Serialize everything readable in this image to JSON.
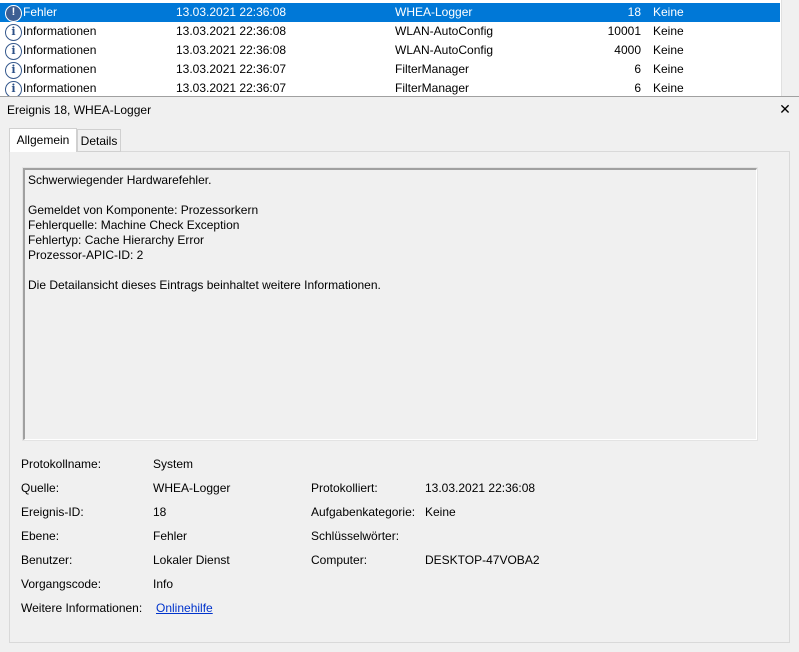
{
  "event_list": {
    "rows": [
      {
        "icon": "error-icon",
        "level": "Fehler",
        "date": "13.03.2021 22:36:08",
        "source": "WHEA-Logger",
        "id": "18",
        "category": "Keine",
        "selected": true
      },
      {
        "icon": "info-icon",
        "level": "Informationen",
        "date": "13.03.2021 22:36:08",
        "source": "WLAN-AutoConfig",
        "id": "10001",
        "category": "Keine"
      },
      {
        "icon": "info-icon",
        "level": "Informationen",
        "date": "13.03.2021 22:36:08",
        "source": "WLAN-AutoConfig",
        "id": "4000",
        "category": "Keine"
      },
      {
        "icon": "info-icon",
        "level": "Informationen",
        "date": "13.03.2021 22:36:07",
        "source": "FilterManager",
        "id": "6",
        "category": "Keine"
      },
      {
        "icon": "info-icon",
        "level": "Informationen",
        "date": "13.03.2021 22:36:07",
        "source": "FilterManager",
        "id": "6",
        "category": "Keine"
      }
    ]
  },
  "detail": {
    "title": "Ereignis 18, WHEA-Logger",
    "close_label": "✕"
  },
  "tabs": {
    "general": "Allgemein",
    "details": "Details"
  },
  "description": {
    "lines": [
      "Schwerwiegender Hardwarefehler.",
      "",
      "Gemeldet von Komponente: Prozessorkern",
      "Fehlerquelle: Machine Check Exception",
      "Fehlertyp: Cache Hierarchy Error",
      "Prozessor-APIC-ID: 2",
      "",
      "Die Detailansicht dieses Eintrags beinhaltet weitere Informationen."
    ]
  },
  "properties": {
    "log_name_label": "Protokollname:",
    "log_name_value": "System",
    "source_label": "Quelle:",
    "source_value": "WHEA-Logger",
    "logged_label": "Protokolliert:",
    "logged_value": "13.03.2021 22:36:08",
    "event_id_label": "Ereignis-ID:",
    "event_id_value": "18",
    "task_cat_label": "Aufgabenkategorie:",
    "task_cat_value": "Keine",
    "level_label": "Ebene:",
    "level_value": "Fehler",
    "keywords_label": "Schlüsselwörter:",
    "keywords_value": "",
    "user_label": "Benutzer:",
    "user_value": "Lokaler Dienst",
    "computer_label": "Computer:",
    "computer_value": "DESKTOP-47VOBA2",
    "opcode_label": "Vorgangscode:",
    "opcode_value": "Info",
    "more_info_label": "Weitere Informationen:",
    "more_info_link": "Onlinehilfe"
  },
  "colors": {
    "selection": "#0078d7",
    "link": "#0033cc"
  }
}
